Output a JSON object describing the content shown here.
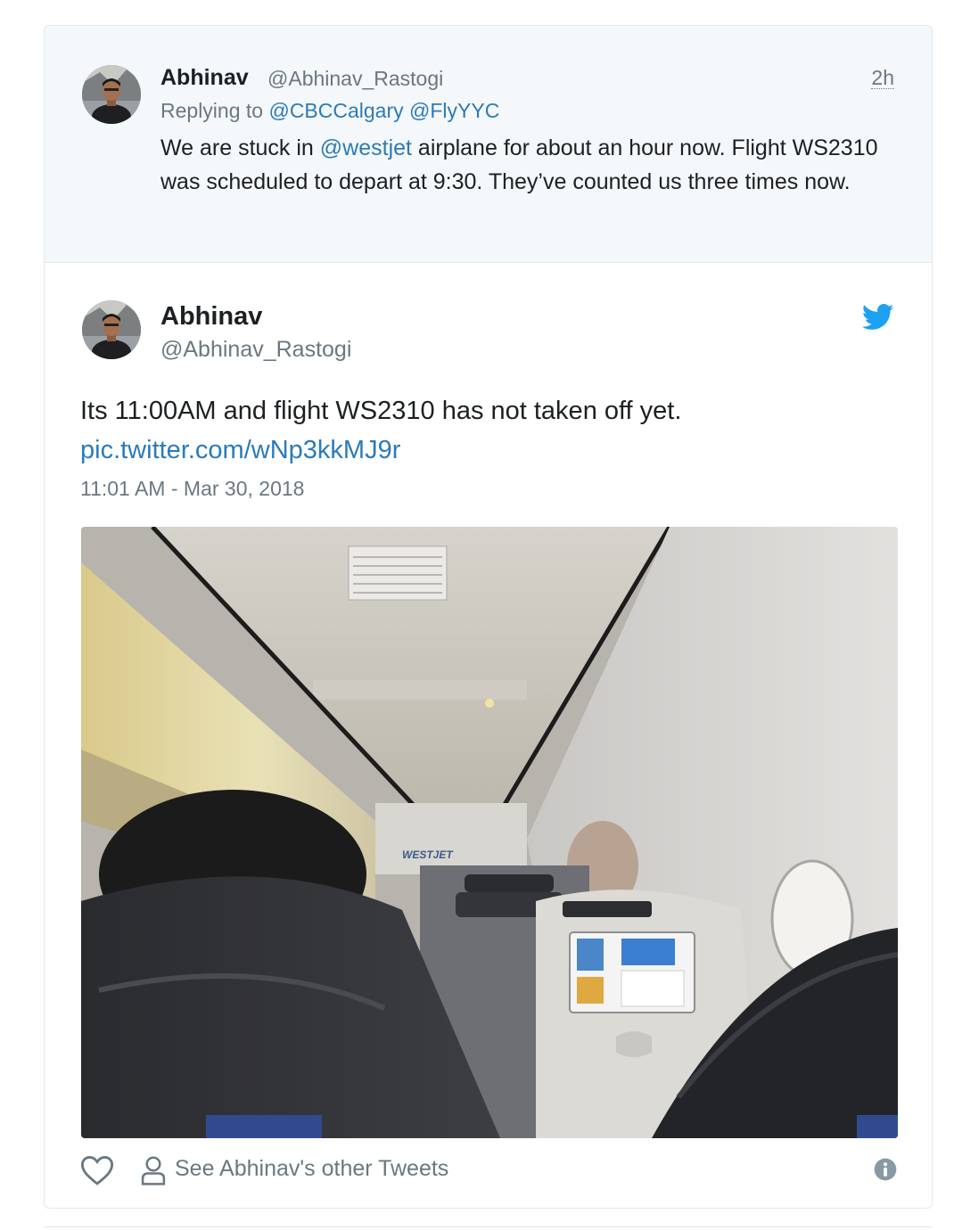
{
  "parent_tweet": {
    "name": "Abhinav",
    "handle": "@Abhinav_Rastogi",
    "time": "2h",
    "replying_prefix": "Replying to ",
    "replying_to": [
      "@CBCCalgary",
      "@FlyYYC"
    ],
    "text_before": "We are stuck in ",
    "mention": "@westjet",
    "text_after": " airplane for about an hour now. Flight WS2310 was scheduled to depart at 9:30. They’ve counted us three times now."
  },
  "main_tweet": {
    "name": "Abhinav",
    "handle": "@Abhinav_Rastogi",
    "text": "Its 11:00AM and flight WS2310 has not taken off yet.",
    "link": "pic.twitter.com/wNp3kkMJ9r",
    "date": "11:01 AM - Mar 30, 2018",
    "photo_label": "WESTJET"
  },
  "footer": {
    "other_tweets": "See Abhinav's other Tweets"
  },
  "icons": {
    "brand": "twitter-bird-icon",
    "like": "heart-icon",
    "profile": "person-icon",
    "info": "info-icon"
  },
  "colors": {
    "link": "#2b7bb9",
    "twitter_blue": "#1da1f2",
    "secondary_text": "#697882",
    "parent_bg": "#f5f8fa",
    "border": "#e1e8ed"
  }
}
